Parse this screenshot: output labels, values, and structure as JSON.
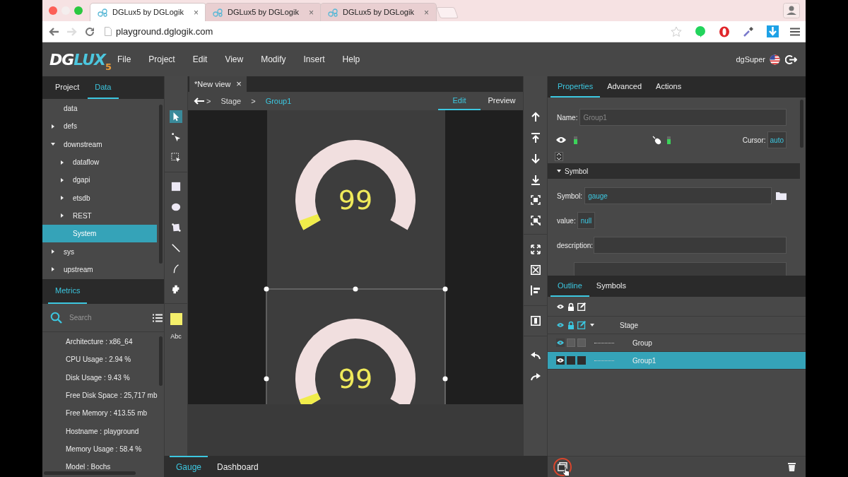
{
  "browser": {
    "tabs": [
      {
        "title": "DGLux5 by DGLogik",
        "close": "×",
        "selected": true
      },
      {
        "title": "DGLux5 by DGLogik",
        "close": "×",
        "selected": false
      },
      {
        "title": "DGLux5 by DGLogik",
        "close": "×",
        "selected": false
      }
    ],
    "url": "playground.dglogik.com"
  },
  "header": {
    "logo": {
      "main": "DG",
      "accent": "LUX",
      "version": "5"
    },
    "menu": [
      "File",
      "Project",
      "Edit",
      "View",
      "Modify",
      "Insert",
      "Help"
    ],
    "user": "dgSuper"
  },
  "left_panel": {
    "tabs": [
      {
        "label": "Project",
        "selected": false
      },
      {
        "label": "Data",
        "selected": true
      }
    ],
    "tree": [
      {
        "label": "data",
        "kind": "leaf",
        "selected": false
      },
      {
        "label": "defs",
        "kind": "folder",
        "expanded": false,
        "selected": false
      },
      {
        "label": "downstream",
        "kind": "folder",
        "expanded": true,
        "selected": false,
        "children": [
          {
            "label": "dataflow",
            "kind": "folder",
            "expanded": false,
            "selected": false
          },
          {
            "label": "dgapi",
            "kind": "folder",
            "expanded": false,
            "selected": false
          },
          {
            "label": "etsdb",
            "kind": "folder",
            "expanded": false,
            "selected": false
          },
          {
            "label": "REST",
            "kind": "folder",
            "expanded": false,
            "selected": false
          },
          {
            "label": "System",
            "kind": "leaf",
            "selected": true
          }
        ]
      },
      {
        "label": "sys",
        "kind": "folder",
        "expanded": false,
        "selected": false
      },
      {
        "label": "upstream",
        "kind": "folder",
        "expanded": false,
        "selected": false
      }
    ],
    "metrics_tabs": [
      {
        "label": "Metrics",
        "selected": true
      }
    ],
    "search": {
      "placeholder": "Search"
    },
    "metrics": [
      "Architecture : x86_64",
      "CPU Usage : 2.94 %",
      "Disk Usage : 9.43 %",
      "Free Disk Space : 25,717 mb",
      "Free Memory : 413.55 mb",
      "Hostname : playground",
      "Memory Usage : 58.4 %",
      "Model : Bochs"
    ]
  },
  "tools": {
    "items": [
      {
        "kind": "select",
        "selected": true
      },
      {
        "kind": "direct-select",
        "selected": false
      },
      {
        "kind": "marquee",
        "selected": false
      },
      {
        "kind": "rectangle",
        "selected": false
      },
      {
        "kind": "ellipse",
        "selected": false
      },
      {
        "kind": "polygon",
        "selected": false
      },
      {
        "kind": "line",
        "selected": false
      },
      {
        "kind": "curve",
        "selected": false
      },
      {
        "kind": "component",
        "selected": false
      }
    ],
    "swatch": {
      "color": "#f4ef6b"
    },
    "text_tool": "Abc"
  },
  "editor": {
    "tabs": [
      {
        "label": "*New view",
        "close": "×",
        "selected": true
      }
    ],
    "breadcrumb": [
      {
        "kind": "separator",
        "label": ">"
      },
      {
        "kind": "crumb",
        "label": "Stage",
        "selected": false
      },
      {
        "kind": "separator",
        "label": ">"
      },
      {
        "kind": "crumb",
        "label": "Group1",
        "selected": true
      }
    ],
    "mode_tabs": [
      {
        "label": "Edit",
        "selected": true
      },
      {
        "label": "Preview",
        "selected": false
      }
    ],
    "gauges": [
      {
        "value": "99",
        "level": 0.04,
        "selected": false
      },
      {
        "value": "99",
        "level": 0.04,
        "selected": true
      }
    ],
    "bottom_tabs": [
      {
        "label": "Gauge",
        "selected": true
      },
      {
        "label": "Dashboard",
        "selected": false
      }
    ]
  },
  "properties": {
    "tabs": [
      {
        "label": "Properties",
        "selected": true
      },
      {
        "label": "Advanced",
        "selected": false
      },
      {
        "label": "Actions",
        "selected": false
      }
    ],
    "name": {
      "label": "Name:",
      "placeholder": "Group1"
    },
    "visible_toggle": {
      "on": true
    },
    "enabled_toggle": {
      "on": true
    },
    "cursor": {
      "label": "Cursor:",
      "value": "auto"
    },
    "section": {
      "label": "Symbol",
      "expanded": true
    },
    "symbol": {
      "label": "Symbol:",
      "value": "gauge"
    },
    "value": {
      "label": "value:",
      "value": "null"
    },
    "description": {
      "label": "description:"
    }
  },
  "outline": {
    "tabs": [
      {
        "label": "Outline",
        "selected": true
      },
      {
        "label": "Symbols",
        "selected": false
      }
    ],
    "rows": [
      {
        "label": "Stage",
        "kind": "stage",
        "selected": false,
        "expanded": true,
        "children": [
          {
            "label": "Group",
            "kind": "group",
            "selected": false
          },
          {
            "label": "Group1",
            "kind": "group",
            "selected": true
          }
        ]
      }
    ]
  }
}
